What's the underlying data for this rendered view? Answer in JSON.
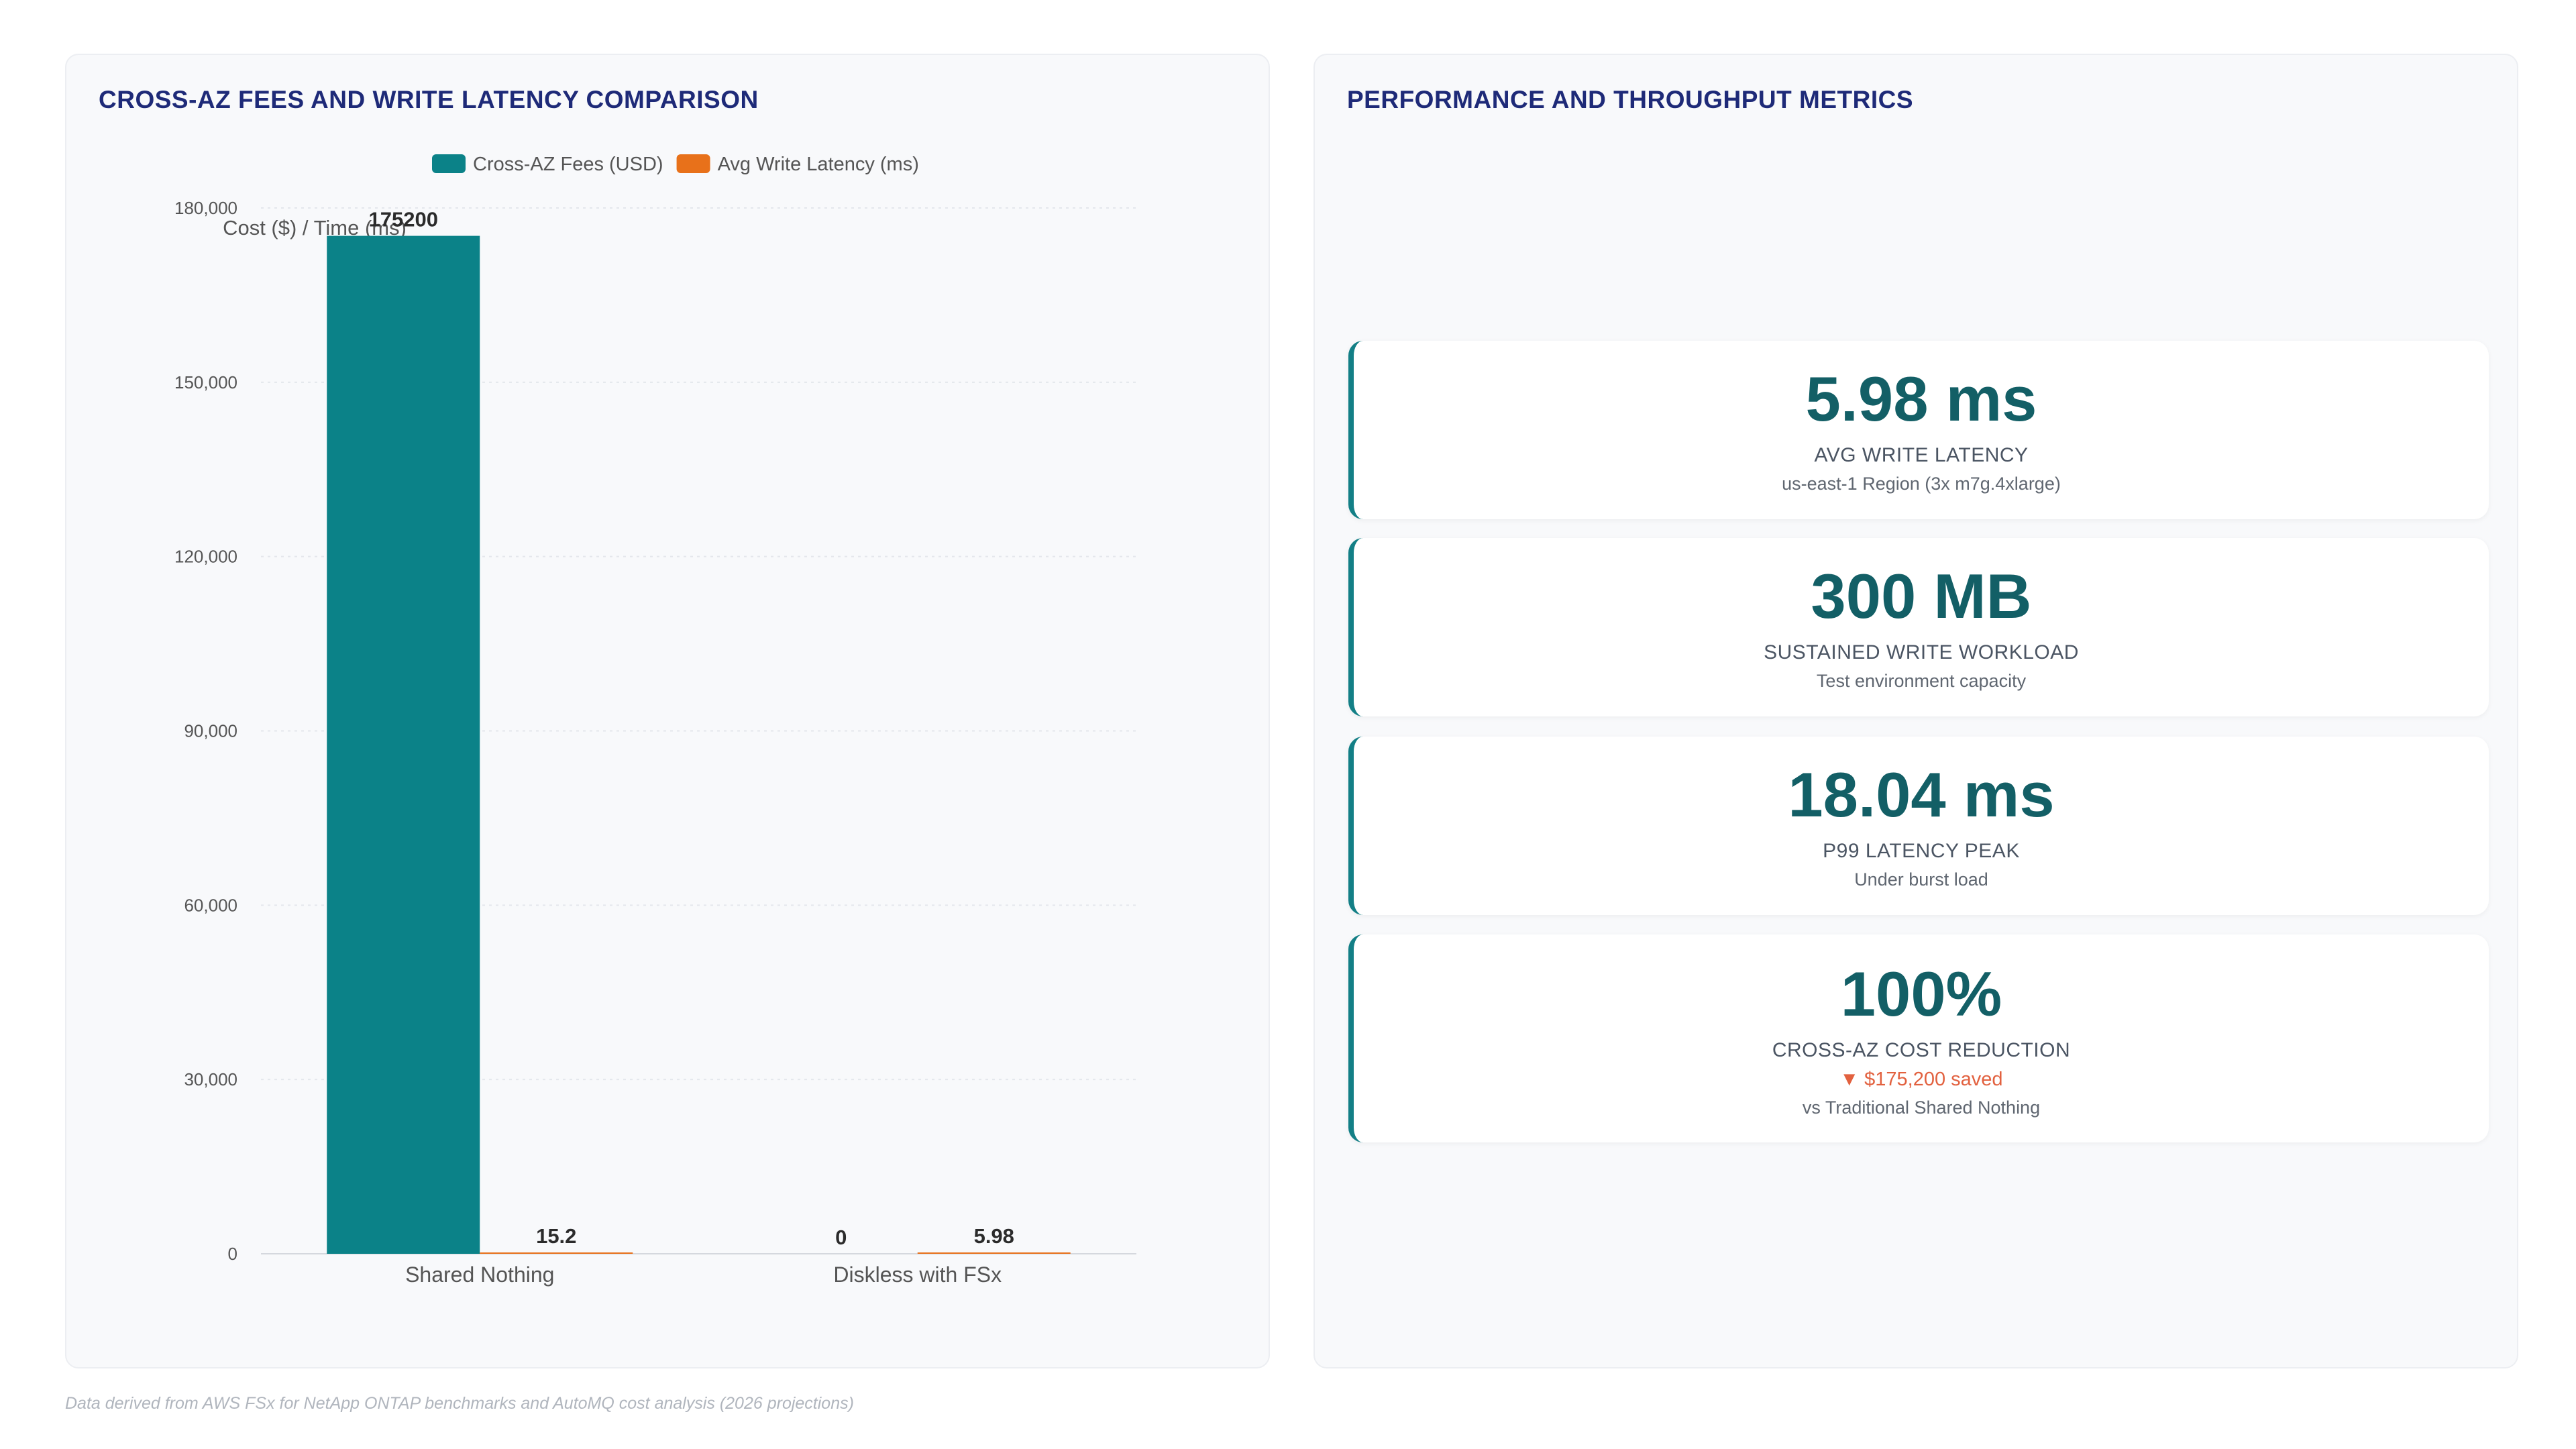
{
  "left_panel": {
    "title": "CROSS-AZ FEES AND WRITE LATENCY COMPARISON"
  },
  "right_panel": {
    "title": "PERFORMANCE AND THROUGHPUT METRICS"
  },
  "chart_data": {
    "type": "bar",
    "title": "",
    "xlabel": "",
    "ylabel": "Cost ($) / Time (ms)",
    "categories": [
      "Shared Nothing",
      "Diskless with FSx"
    ],
    "series": [
      {
        "name": "Cross-AZ Fees (USD)",
        "color": "#0b8288",
        "values": [
          175200,
          0
        ],
        "labels": [
          "175200",
          "0"
        ]
      },
      {
        "name": "Avg Write Latency (ms)",
        "color": "#e8711a",
        "values": [
          15.2,
          5.98
        ],
        "labels": [
          "15.2",
          "5.98"
        ]
      }
    ],
    "ylim": [
      0,
      180000
    ],
    "yticks": [
      0,
      30000,
      60000,
      90000,
      120000,
      150000,
      180000
    ],
    "ytick_labels": [
      "0",
      "30,000",
      "60,000",
      "90,000",
      "120,000",
      "150,000",
      "180,000"
    ],
    "grid": true,
    "legend_position": "top"
  },
  "metrics": [
    {
      "value": "5.98 ms",
      "label": "AVG WRITE LATENCY",
      "sub": "us-east-1 Region (3x m7g.4xlarge)"
    },
    {
      "value": "300 MB",
      "label": "SUSTAINED WRITE WORKLOAD",
      "sub": "Test environment capacity"
    },
    {
      "value": "18.04 ms",
      "label": "P99 LATENCY PEAK",
      "sub": "Under burst load"
    },
    {
      "value": "100%",
      "label": "CROSS-AZ COST REDUCTION",
      "saved": "▼ $175,200 saved",
      "sub": "vs Traditional Shared Nothing"
    }
  ],
  "footer": "Data derived from AWS FSx for NetApp ONTAP benchmarks and AutoMQ cost analysis (2026 projections)"
}
